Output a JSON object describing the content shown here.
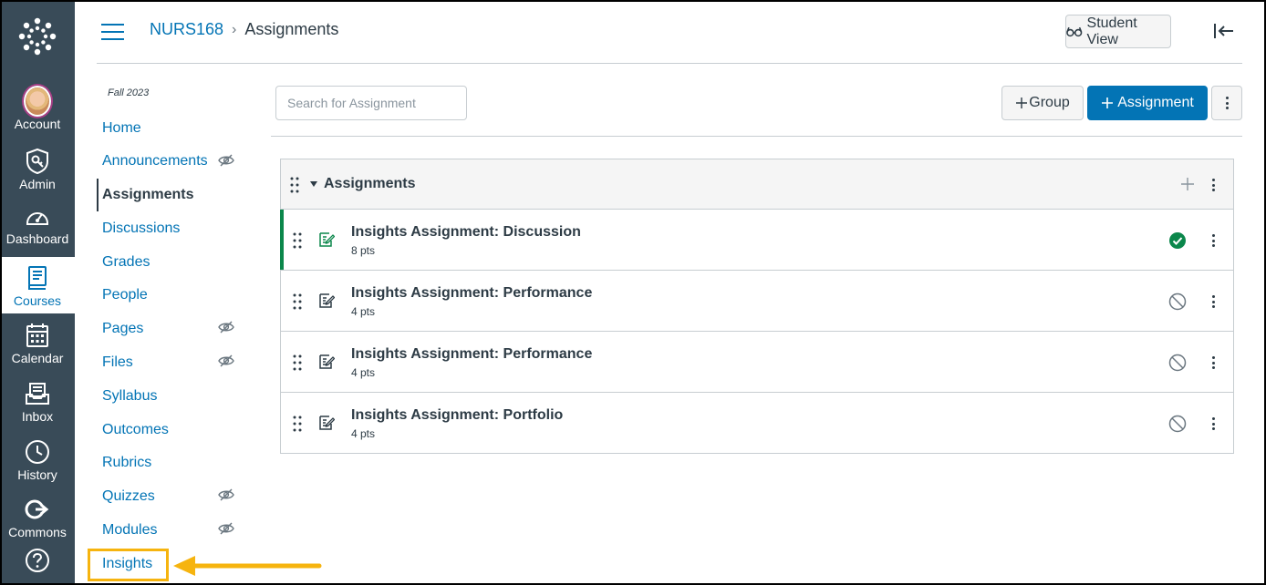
{
  "global_nav": {
    "items": [
      {
        "label": "Account",
        "icon": "avatar"
      },
      {
        "label": "Admin",
        "icon": "admin-shield-icon"
      },
      {
        "label": "Dashboard",
        "icon": "dashboard-gauge-icon"
      },
      {
        "label": "Courses",
        "icon": "courses-book-icon"
      },
      {
        "label": "Calendar",
        "icon": "calendar-icon"
      },
      {
        "label": "Inbox",
        "icon": "inbox-icon"
      },
      {
        "label": "History",
        "icon": "history-clock-icon"
      },
      {
        "label": "Commons",
        "icon": "commons-share-icon"
      },
      {
        "label": "",
        "icon": "help-icon"
      }
    ],
    "active": "Courses",
    "bg_color": "#394b58"
  },
  "header": {
    "course": "NURS168",
    "separator": "›",
    "current": "Assignments",
    "student_view_label": "Student View"
  },
  "course_nav": {
    "term": "Fall 2023",
    "items": [
      {
        "label": "Home",
        "hidden": false
      },
      {
        "label": "Announcements",
        "hidden": true
      },
      {
        "label": "Assignments",
        "hidden": false,
        "active": true
      },
      {
        "label": "Discussions",
        "hidden": false
      },
      {
        "label": "Grades",
        "hidden": false
      },
      {
        "label": "People",
        "hidden": false
      },
      {
        "label": "Pages",
        "hidden": true
      },
      {
        "label": "Files",
        "hidden": true
      },
      {
        "label": "Syllabus",
        "hidden": false
      },
      {
        "label": "Outcomes",
        "hidden": false
      },
      {
        "label": "Rubrics",
        "hidden": false
      },
      {
        "label": "Quizzes",
        "hidden": true
      },
      {
        "label": "Modules",
        "hidden": true
      },
      {
        "label": "Insights",
        "hidden": false,
        "highlighted": true
      }
    ]
  },
  "toolbar": {
    "search_placeholder": "Search for Assignment",
    "group_label": "Group",
    "assignment_label": "Assignment"
  },
  "assignment_group": {
    "title": "Assignments",
    "assignments": [
      {
        "title": "Insights Assignment: Discussion",
        "points": "8 pts",
        "published": true
      },
      {
        "title": "Insights Assignment: Performance",
        "points": "4 pts",
        "published": false
      },
      {
        "title": "Insights Assignment: Performance",
        "points": "4 pts",
        "published": false
      },
      {
        "title": "Insights Assignment: Portfolio",
        "points": "4 pts",
        "published": false
      }
    ]
  },
  "colors": {
    "link": "#0374b5",
    "published": "#0b874b",
    "highlight": "#f6b40f"
  }
}
